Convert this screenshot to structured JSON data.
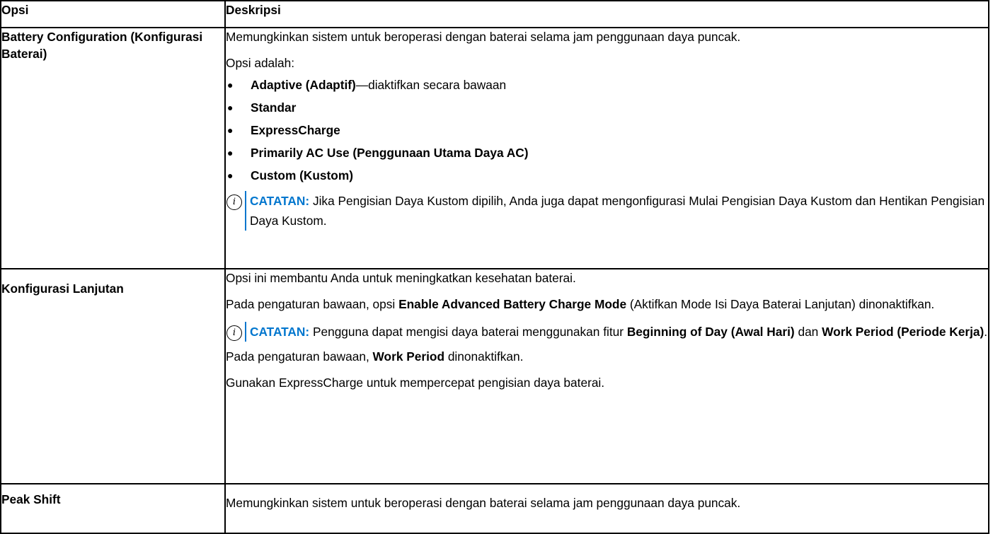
{
  "table": {
    "headers": {
      "option": "Opsi",
      "description": "Deskripsi"
    },
    "rows": [
      {
        "option": "Battery Configuration (Konfigurasi Baterai)",
        "intro": "Memungkinkan sistem untuk beroperasi dengan baterai selama jam penggunaan daya puncak.",
        "options_label": "Opsi adalah:",
        "options": [
          {
            "name": "Adaptive (Adaptif)",
            "suffix": "—diaktifkan secara bawaan"
          },
          {
            "name": "Standar",
            "suffix": ""
          },
          {
            "name": "ExpressCharge",
            "suffix": ""
          },
          {
            "name": "Primarily AC Use (Penggunaan Utama Daya AC)",
            "suffix": ""
          },
          {
            "name": "Custom (Kustom)",
            "suffix": ""
          }
        ],
        "note": {
          "label": "CATATAN:",
          "text": " Jika Pengisian Daya Kustom dipilih, Anda juga dapat mengonfigurasi Mulai Pengisian Daya Kustom dan Hentikan Pengisian Daya Kustom."
        }
      },
      {
        "option": "Konfigurasi Lanjutan",
        "intro": "Opsi ini membantu Anda untuk meningkatkan kesehatan baterai.",
        "default_text": {
          "before": "Pada pengaturan bawaan, opsi ",
          "bold": "Enable Advanced Battery Charge Mode",
          "after": " (Aktifkan Mode Isi Daya Baterai Lanjutan) dinonaktifkan."
        },
        "note": {
          "label": "CATATAN:",
          "before": " Pengguna dapat mengisi daya baterai menggunakan fitur ",
          "bold1": "Beginning of Day (Awal Hari)",
          "middle": " dan ",
          "bold2": "Work Period (Periode Kerja)",
          "after": "."
        },
        "work_period": {
          "before": "Pada pengaturan bawaan, ",
          "bold": "Work Period",
          "after": " dinonaktifkan."
        },
        "express": "Gunakan ExpressCharge untuk mempercepat pengisian daya baterai."
      },
      {
        "option": "Peak Shift",
        "intro": "Memungkinkan sistem untuk beroperasi dengan baterai selama jam penggunaan daya puncak."
      }
    ]
  },
  "icons": {
    "note_icon": "info-icon",
    "note_glyph": "i",
    "bullet_glyph": "●"
  },
  "colors": {
    "note_accent": "#0076ce",
    "border": "#000000"
  }
}
